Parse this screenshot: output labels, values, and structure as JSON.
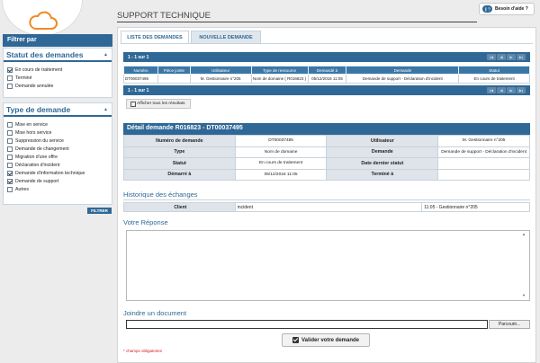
{
  "page": {
    "title": "SUPPORT TECHNIQUE",
    "help_label": "Besoin d'aide ?"
  },
  "sidebar": {
    "filter_title": "Filtrer par",
    "status": {
      "title": "Statut des demandes",
      "items": [
        {
          "label": "En cours de traitement",
          "checked": true
        },
        {
          "label": "Terminé",
          "checked": false
        },
        {
          "label": "Demande annulée",
          "checked": false
        }
      ]
    },
    "type": {
      "title": "Type de demande",
      "items": [
        {
          "label": "Mise en service",
          "checked": false
        },
        {
          "label": "Mise hors service",
          "checked": false
        },
        {
          "label": "Suppression du service",
          "checked": false
        },
        {
          "label": "Demande de changement",
          "checked": false
        },
        {
          "label": "Migration d'une offre",
          "checked": false
        },
        {
          "label": "Déclaration d'incident",
          "checked": false
        },
        {
          "label": "Demande d'information technique",
          "checked": true
        },
        {
          "label": "Demande de support",
          "checked": true
        },
        {
          "label": "Autres",
          "checked": false
        }
      ]
    },
    "filter_button": "FILTRER"
  },
  "tabs": {
    "list": "LISTE DES DEMANDES",
    "new": "NOUVELLE DEMANDE"
  },
  "results": {
    "pager_top": "1 - 1 sur 1",
    "pager_bottom": "1 - 1 sur 1",
    "headers": [
      "Numéro",
      "Pièce jointe",
      "Utilisateur",
      "Type de ressource",
      "Demandé à",
      "Demande",
      "Statut"
    ],
    "row": [
      "DT00037495",
      "",
      "M. Gestionnaire n°205",
      "Nom de domaine ( R016823 )",
      "05/12/2016 11:05",
      "Demande de support - Déclaration d'incident",
      "En cours de traitement"
    ],
    "show_all": "Afficher tous les résultats"
  },
  "detail": {
    "title": "Détail demande R016823 - DT00037495",
    "labels": {
      "numero": "Numéro de demande",
      "utilisateur": "Utilisateur",
      "type": "Type",
      "demande": "Demande",
      "statut": "Statut",
      "dernier_statut": "Date dernier statut",
      "demarre": "Démarré à",
      "termine": "Terminé à"
    },
    "values": {
      "numero": "DT00037495",
      "utilisateur": "M. Gestionnaire n°205",
      "type": "Nom de domaine",
      "demande": "Demande de support - Déclaration d'incident",
      "statut": "En cours de traitement",
      "dernier_statut": "",
      "demarre": "05/12/2016 11:05",
      "termine": ""
    }
  },
  "history": {
    "title": "Historique des échanges",
    "label": "Client",
    "message": "incident",
    "meta": "11:05 - Gestionnaire n°205"
  },
  "reply": {
    "title": "Votre Réponse",
    "value": ""
  },
  "attach": {
    "title": "Joindre un document",
    "browse": "Parcourir..."
  },
  "submit": "Valider votre demande",
  "required_note": "* champs obligatoires",
  "colors": {
    "primary": "#2f6896",
    "required": "#d02020"
  }
}
